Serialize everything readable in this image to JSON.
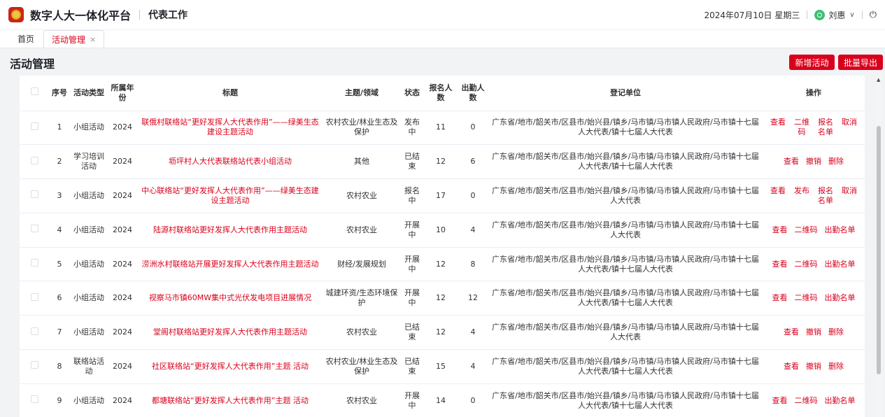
{
  "header": {
    "app_title": "数字人大一体化平台",
    "module_title": "代表工作",
    "date": "2024年07月10日 星期三",
    "user_name": "刘惠",
    "caret": "∨",
    "power_icon": "⏻"
  },
  "tabs": [
    {
      "label": "首页"
    },
    {
      "label": "活动管理",
      "close": "×"
    }
  ],
  "page": {
    "title": "活动管理",
    "add_button": "新增活动",
    "export_button": "批量导出"
  },
  "columns": [
    "序号",
    "活动类型",
    "所属年份",
    "标题",
    "主题/领域",
    "状态",
    "报名人数",
    "出勤人数",
    "登记单位",
    "操作"
  ],
  "rows": [
    {
      "no": "1",
      "type": "小组活动",
      "year": "2024",
      "title": "联俄村联络站“更好发挥人大代表作用”——绿美生态建设主题活动",
      "domain": "农村农业/林业生态及保护",
      "status": "发布中",
      "signup": "11",
      "attend": "0",
      "unit": "广东省/地市/韶关市/区县市/始兴县/镇乡/马市镇/马市镇人民政府/马市镇十七届人大代表/镇十七届人大代表",
      "ops": [
        "查看",
        "二维码",
        "报名名单",
        "取消"
      ],
      "ops_split": true
    },
    {
      "no": "2",
      "type": "学习培训活动",
      "year": "2024",
      "title": "坜坪村人大代表联络站代表小组活动",
      "domain": "其他",
      "status": "已结束",
      "signup": "12",
      "attend": "6",
      "unit": "广东省/地市/韶关市/区县市/始兴县/镇乡/马市镇/马市镇人民政府/马市镇十七届人大代表/镇十七届人大代表",
      "ops": [
        "查看",
        "撤销",
        "删除"
      ],
      "ops_split": false
    },
    {
      "no": "3",
      "type": "小组活动",
      "year": "2024",
      "title": "中心联络站“更好发挥人大代表作用”——绿美生态建设主题活动",
      "domain": "农村农业",
      "status": "报名中",
      "signup": "17",
      "attend": "0",
      "unit": "广东省/地市/韶关市/区县市/始兴县/镇乡/马市镇/马市镇人民政府/马市镇十七届人大代表",
      "ops": [
        "查看",
        "发布",
        "报名名单",
        "取消"
      ],
      "ops_split": true
    },
    {
      "no": "4",
      "type": "小组活动",
      "year": "2024",
      "title": "陆源村联络站更好发挥人大代表作用主题活动",
      "domain": "农村农业",
      "status": "开展中",
      "signup": "10",
      "attend": "4",
      "unit": "广东省/地市/韶关市/区县市/始兴县/镇乡/马市镇/马市镇人民政府/马市镇十七届人大代表",
      "ops": [
        "查看",
        "二维码",
        "出勤名单"
      ],
      "ops_split": false
    },
    {
      "no": "5",
      "type": "小组活动",
      "year": "2024",
      "title": "涝洲水村联络站开展更好发挥人大代表作用主题活动",
      "domain": "财经/发展规划",
      "status": "开展中",
      "signup": "12",
      "attend": "8",
      "unit": "广东省/地市/韶关市/区县市/始兴县/镇乡/马市镇/马市镇人民政府/马市镇十七届人大代表/镇十七届人大代表",
      "ops": [
        "查看",
        "二维码",
        "出勤名单"
      ],
      "ops_split": false
    },
    {
      "no": "6",
      "type": "小组活动",
      "year": "2024",
      "title": "视察马市镇60MW集中式光伏发电项目进展情况",
      "domain": "城建环资/生态环境保护",
      "status": "开展中",
      "signup": "12",
      "attend": "12",
      "unit": "广东省/地市/韶关市/区县市/始兴县/镇乡/马市镇/马市镇人民政府/马市镇十七届人大代表/镇十七届人大代表",
      "ops": [
        "查看",
        "二维码",
        "出勤名单"
      ],
      "ops_split": false
    },
    {
      "no": "7",
      "type": "小组活动",
      "year": "2024",
      "title": "堂阁村联络站更好发挥人大代表作用主题活动",
      "domain": "农村农业",
      "status": "已结束",
      "signup": "12",
      "attend": "4",
      "unit": "广东省/地市/韶关市/区县市/始兴县/镇乡/马市镇/马市镇人民政府/马市镇十七届人大代表",
      "ops": [
        "查看",
        "撤销",
        "删除"
      ],
      "ops_split": false
    },
    {
      "no": "8",
      "type": "联络站活动",
      "year": "2024",
      "title": "社区联络站“更好发挥人大代表作用”主题 活动",
      "domain": "农村农业/林业生态及保护",
      "status": "已结束",
      "signup": "15",
      "attend": "4",
      "unit": "广东省/地市/韶关市/区县市/始兴县/镇乡/马市镇/马市镇人民政府/马市镇十七届人大代表/镇十七届人大代表",
      "ops": [
        "查看",
        "撤销",
        "删除"
      ],
      "ops_split": false
    },
    {
      "no": "9",
      "type": "小组活动",
      "year": "2024",
      "title": "都塘联络站“更好发挥人大代表作用”主题 活动",
      "domain": "农村农业",
      "status": "开展中",
      "signup": "14",
      "attend": "0",
      "unit": "广东省/地市/韶关市/区县市/始兴县/镇乡/马市镇/马市镇人民政府/马市镇十七届人大代表/镇十七届人大代表",
      "ops": [
        "查看",
        "二维码",
        "出勤名单"
      ],
      "ops_split": false
    }
  ],
  "colors": {
    "accent": "#d9001b",
    "avatar": "#3cbf72",
    "logo": "#c8261a"
  },
  "icons": {
    "logo": "emblem-icon",
    "avatar": "user-avatar-icon",
    "power": "power-icon",
    "close": "close-icon"
  }
}
